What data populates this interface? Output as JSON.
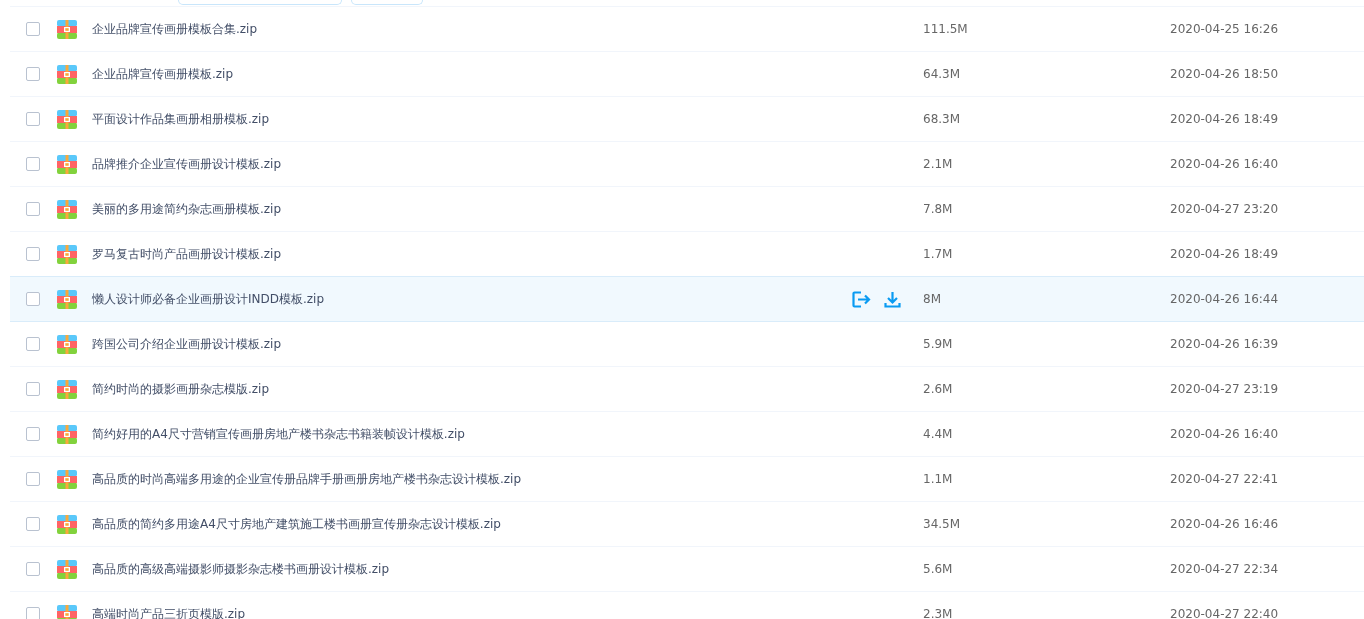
{
  "files": [
    {
      "name": "企业品牌宣传画册模板合集.zip",
      "size": "111.5M",
      "date": "2020-04-25 16:26",
      "checked": false,
      "hovered": false
    },
    {
      "name": "企业品牌宣传画册模板.zip",
      "size": "64.3M",
      "date": "2020-04-26 18:50",
      "checked": false,
      "hovered": false
    },
    {
      "name": "平面设计作品集画册相册模板.zip",
      "size": "68.3M",
      "date": "2020-04-26 18:49",
      "checked": false,
      "hovered": false
    },
    {
      "name": "品牌推介企业宣传画册设计模板.zip",
      "size": "2.1M",
      "date": "2020-04-26 16:40",
      "checked": false,
      "hovered": false
    },
    {
      "name": "美丽的多用途简约杂志画册模板.zip",
      "size": "7.8M",
      "date": "2020-04-27 23:20",
      "checked": false,
      "hovered": false
    },
    {
      "name": "罗马复古时尚产品画册设计模板.zip",
      "size": "1.7M",
      "date": "2020-04-26 18:49",
      "checked": false,
      "hovered": false
    },
    {
      "name": "懒人设计师必备企业画册设计INDD模板.zip",
      "size": "8M",
      "date": "2020-04-26 16:44",
      "checked": false,
      "hovered": true
    },
    {
      "name": "跨国公司介绍企业画册设计模板.zip",
      "size": "5.9M",
      "date": "2020-04-26 16:39",
      "checked": false,
      "hovered": false
    },
    {
      "name": "简约时尚的摄影画册杂志模版.zip",
      "size": "2.6M",
      "date": "2020-04-27 23:19",
      "checked": false,
      "hovered": false
    },
    {
      "name": "简约好用的A4尺寸营销宣传画册房地产楼书杂志书籍装帧设计模板.zip",
      "size": "4.4M",
      "date": "2020-04-26 16:40",
      "checked": false,
      "hovered": false
    },
    {
      "name": "高品质的时尚高端多用途的企业宣传册品牌手册画册房地产楼书杂志设计模板.zip",
      "size": "1.1M",
      "date": "2020-04-27 22:41",
      "checked": false,
      "hovered": false
    },
    {
      "name": "高品质的简约多用途A4尺寸房地产建筑施工楼书画册宣传册杂志设计模板.zip",
      "size": "34.5M",
      "date": "2020-04-26 16:46",
      "checked": false,
      "hovered": false
    },
    {
      "name": "高品质的高级高端摄影师摄影杂志楼书画册设计模板.zip",
      "size": "5.6M",
      "date": "2020-04-27 22:34",
      "checked": false,
      "hovered": false
    },
    {
      "name": "高端时尚产品三折页模版.zip",
      "size": "2.3M",
      "date": "2020-04-27 22:40",
      "checked": false,
      "hovered": false
    }
  ]
}
